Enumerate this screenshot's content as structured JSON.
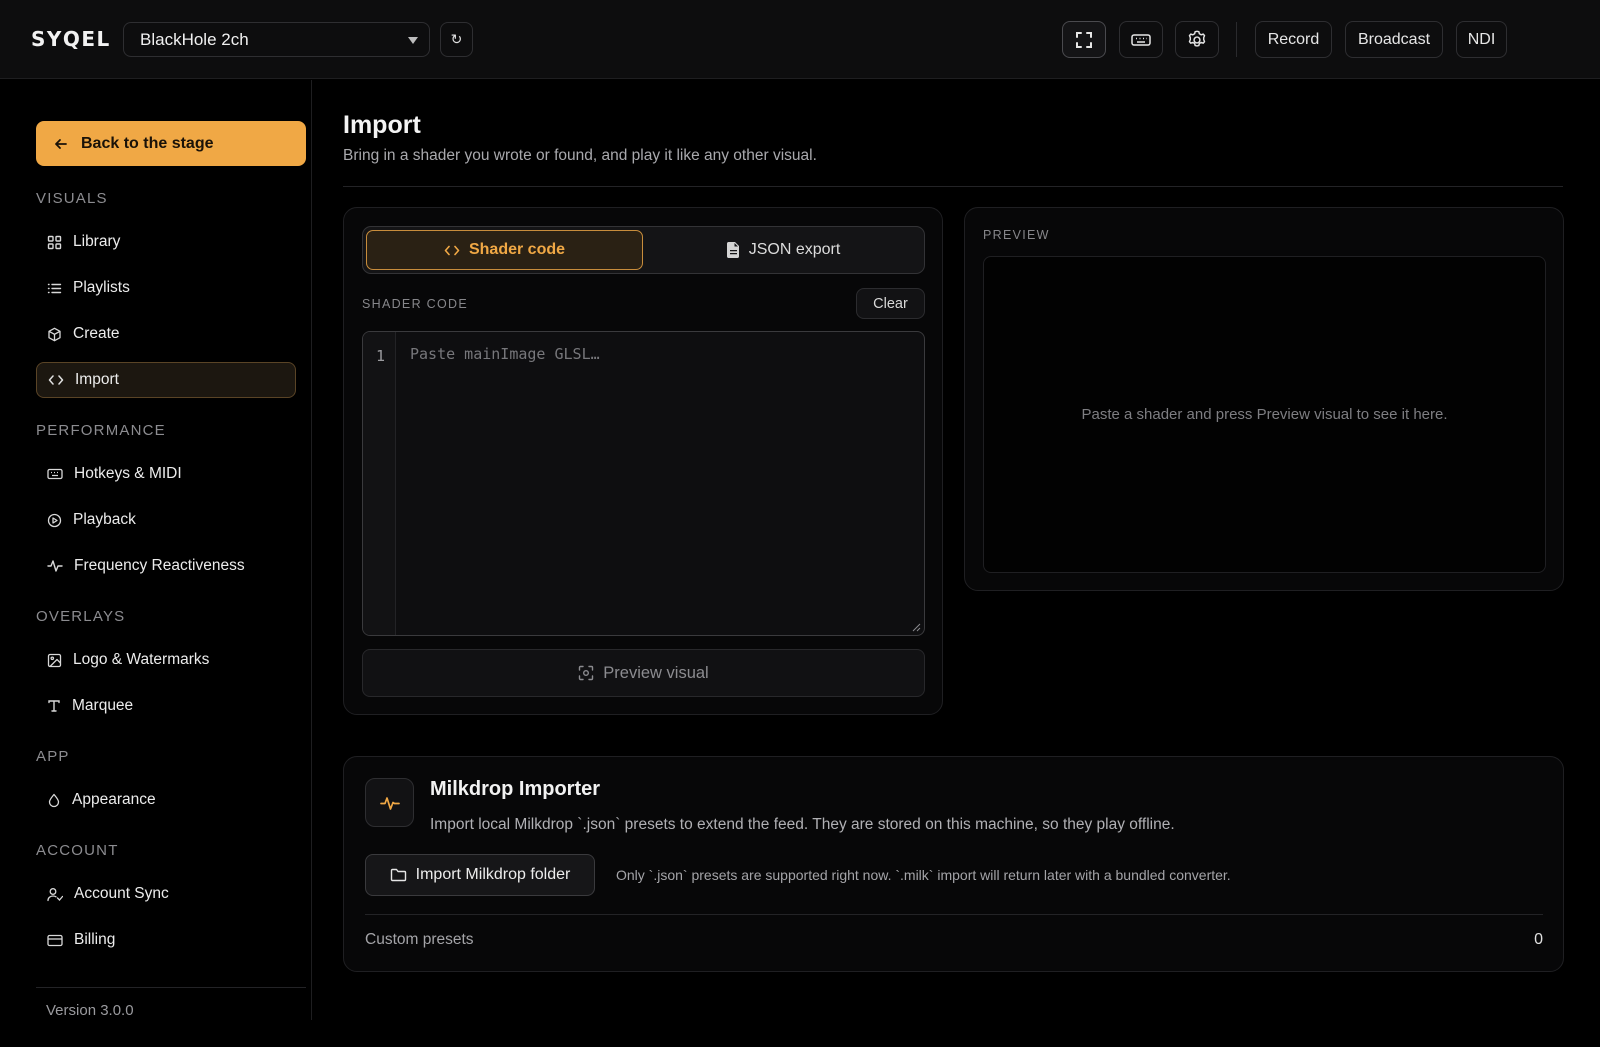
{
  "app": {
    "logo": "SYQEL"
  },
  "header": {
    "device": "BlackHole 2ch",
    "refresh_glyph": "↻",
    "buttons": {
      "record": "Record",
      "broadcast": "Broadcast",
      "ndi": "NDI"
    }
  },
  "sidebar": {
    "back_label": "Back to the stage",
    "sections": {
      "visuals": "VISUALS",
      "performance": "PERFORMANCE",
      "overlays": "OVERLAYS",
      "app": "APP",
      "account": "ACCOUNT"
    },
    "items": {
      "library": "Library",
      "playlists": "Playlists",
      "create": "Create",
      "import": "Import",
      "hotkeys": "Hotkeys & MIDI",
      "playback": "Playback",
      "frequency": "Frequency Reactiveness",
      "logo": "Logo & Watermarks",
      "marquee": "Marquee",
      "appearance": "Appearance",
      "account_sync": "Account Sync",
      "billing": "Billing"
    },
    "active": "import",
    "version": "Version 3.0.0"
  },
  "page": {
    "title": "Import",
    "subtitle": "Bring in a shader you wrote or found, and play it like any other visual."
  },
  "editor": {
    "tabs": {
      "shader": "Shader code",
      "json": "JSON export"
    },
    "active_tab": "shader",
    "section_label": "SHADER CODE",
    "clear_label": "Clear",
    "line_number": "1",
    "placeholder": "Paste mainImage GLSL…",
    "value": "",
    "preview_button": "Preview visual"
  },
  "preview": {
    "label": "PREVIEW",
    "empty_text": "Paste a shader and press Preview visual to see it here."
  },
  "milkdrop": {
    "title": "Milkdrop Importer",
    "description": "Import local Milkdrop `.json` presets to extend the feed. They are stored on this machine, so they play offline.",
    "button": "Import Milkdrop folder",
    "note": "Only `.json` presets are supported right now. `.milk` import will return later with a bundled converter.",
    "presets_label": "Custom presets",
    "presets_count": "0"
  },
  "colors": {
    "accent": "#f0a845",
    "background": "#000000",
    "panel": "#0d0d0e"
  }
}
